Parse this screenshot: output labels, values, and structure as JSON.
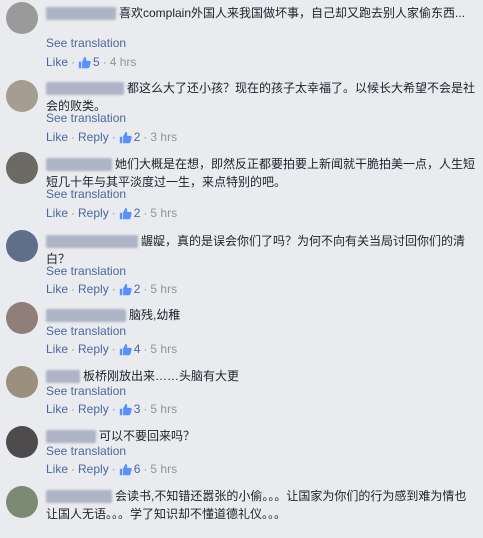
{
  "comments": [
    {
      "text": "喜欢complain外国人来我国做坏事，自己却又跑去别人家偷东西...",
      "see": "See translation",
      "like": "Like",
      "reply": "",
      "likes": "5",
      "time": "4 hrs"
    },
    {
      "text": "都这么大了还小孩？现在的孩子太幸福了。以候长大希望不会是社会的败类。",
      "see": "See translation",
      "like": "Like",
      "reply": "Reply",
      "likes": "2",
      "time": "3 hrs"
    },
    {
      "text": "她们大概是在想，即然反正都要拍要上新闻就干脆拍美一点，人生短短几十年与其平淡度过一生，来点特别的吧。",
      "see": "See translation",
      "like": "Like",
      "reply": "Reply",
      "likes": "2",
      "time": "5 hrs"
    },
    {
      "text": "龌龊，真的是误会你们了吗？为何不向有关当局讨回你们的清白？",
      "see": "See translation",
      "like": "Like",
      "reply": "Reply",
      "likes": "2",
      "time": "5 hrs"
    },
    {
      "text": "脑残,幼稚",
      "see": "See translation",
      "like": "Like",
      "reply": "Reply",
      "likes": "4",
      "time": "5 hrs"
    },
    {
      "text": "板桥刚放出来……头脑有大更",
      "see": "See translation",
      "like": "Like",
      "reply": "Reply",
      "likes": "3",
      "time": "5 hrs"
    },
    {
      "text": "可以不要回来吗？",
      "see": "See translation",
      "like": "Like",
      "reply": "Reply",
      "likes": "6",
      "time": "5 hrs"
    },
    {
      "text": "会读书,不知错还嚣张的小偷。。。让国家为你们的行为感到难为情也让国人无语。。。学了知识却不懂道德礼仪。。。",
      "see": "",
      "like": "",
      "reply": "",
      "likes": "",
      "time": ""
    }
  ],
  "colors": {
    "link": "#4b67a1",
    "meta": "#90949c",
    "background": "#e9ebee"
  }
}
